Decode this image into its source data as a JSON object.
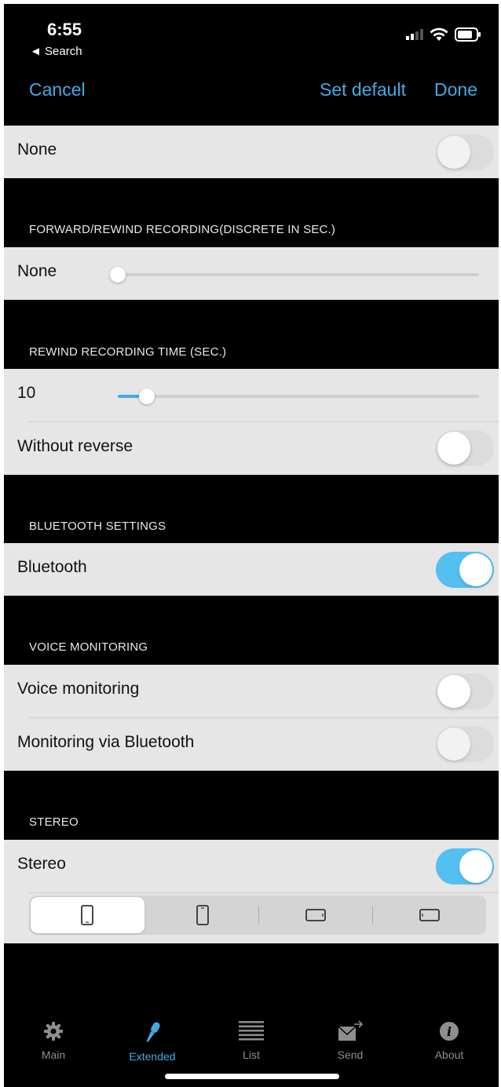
{
  "status": {
    "time": "6:55",
    "back_label": "◄ Search"
  },
  "nav": {
    "cancel": "Cancel",
    "set_default": "Set default",
    "done": "Done"
  },
  "top_row": {
    "label": "None",
    "toggle_on": false
  },
  "forward_rewind": {
    "header": "FORWARD/REWIND RECORDING(DISCRETE IN SEC.)",
    "label": "None",
    "slider_fraction": 0.0
  },
  "rewind_time": {
    "header": "REWIND RECORDING TIME (SEC.)",
    "label": "10",
    "slider_fraction": 0.06,
    "reverse_label": "Without reverse",
    "reverse_on": false
  },
  "bluetooth": {
    "header": "BLUETOOTH SETTINGS",
    "label": "Bluetooth",
    "on": true
  },
  "voice": {
    "header": "VOICE MONITORING",
    "monitoring_label": "Voice monitoring",
    "monitoring_on": false,
    "via_bt_label": "Monitoring via Bluetooth",
    "via_bt_on": false
  },
  "stereo": {
    "header": "STEREO",
    "label": "Stereo",
    "on": true,
    "orientations": [
      "phone-portrait-icon",
      "phone-portrait-alt-icon",
      "phone-landscape-right-icon",
      "phone-landscape-left-icon"
    ],
    "selected_index": 0
  },
  "tabs": [
    {
      "label": "Main",
      "icon": "gear-icon"
    },
    {
      "label": "Extended",
      "icon": "microphone-icon"
    },
    {
      "label": "List",
      "icon": "list-icon"
    },
    {
      "label": "Send",
      "icon": "envelope-icon"
    },
    {
      "label": "About",
      "icon": "info-icon"
    }
  ],
  "active_tab": 1,
  "colors": {
    "accent": "#45a9e3",
    "toggle_on": "#54c0f2",
    "row_bg": "#e6e6e6"
  }
}
